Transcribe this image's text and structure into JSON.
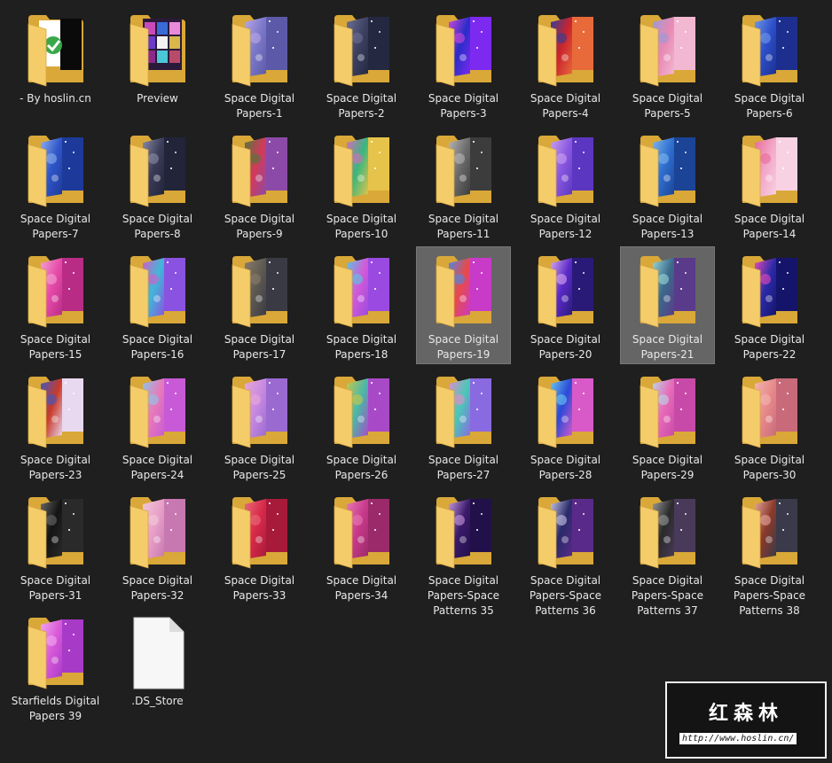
{
  "items": [
    {
      "label": "- By hoslin.cn",
      "kind": "folder",
      "thumb": "hoslin"
    },
    {
      "label": "Preview",
      "kind": "folder",
      "thumb": "preview"
    },
    {
      "label": "Space Digital Papers-1",
      "kind": "folder",
      "colors": [
        "#7b78c9",
        "#b9a8e6",
        "#5c5aa8"
      ]
    },
    {
      "label": "Space Digital Papers-2",
      "kind": "folder",
      "colors": [
        "#3d4263",
        "#6c7092",
        "#242841"
      ]
    },
    {
      "label": "Space Digital Papers-3",
      "kind": "folder",
      "colors": [
        "#2a2cc9",
        "#d04ad8",
        "#7d2af0"
      ]
    },
    {
      "label": "Space Digital Papers-4",
      "kind": "folder",
      "colors": [
        "#c9242d",
        "#2e3f9a",
        "#e86a3a"
      ]
    },
    {
      "label": "Space Digital Papers-5",
      "kind": "folder",
      "colors": [
        "#e889b4",
        "#9a9ad8",
        "#f2b8d2"
      ]
    },
    {
      "label": "Space Digital Papers-6",
      "kind": "folder",
      "colors": [
        "#2c4ec9",
        "#6f9ae8",
        "#1c2f8f"
      ]
    },
    {
      "label": "Space Digital Papers-7",
      "kind": "folder",
      "colors": [
        "#2f55c8",
        "#8fb0ee",
        "#1d3a9a"
      ]
    },
    {
      "label": "Space Digital Papers-8",
      "kind": "folder",
      "colors": [
        "#3a3c58",
        "#8b8da8",
        "#22243a"
      ]
    },
    {
      "label": "Space Digital Papers-9",
      "kind": "folder",
      "colors": [
        "#d33a5a",
        "#4f7a3a",
        "#8c4aa8"
      ]
    },
    {
      "label": "Space Digital Papers-10",
      "kind": "folder",
      "colors": [
        "#39b77e",
        "#d96ac0",
        "#e6c34a"
      ]
    },
    {
      "label": "Space Digital Papers-11",
      "kind": "folder",
      "colors": [
        "#6c6c6c",
        "#b8b8b8",
        "#3c3c3c"
      ]
    },
    {
      "label": "Space Digital Papers-12",
      "kind": "folder",
      "colors": [
        "#8a58e0",
        "#c9a2f2",
        "#5b36c0"
      ]
    },
    {
      "label": "Space Digital Papers-13",
      "kind": "folder",
      "colors": [
        "#2f6fd0",
        "#7fb6ec",
        "#1b4396"
      ]
    },
    {
      "label": "Space Digital Papers-14",
      "kind": "folder",
      "colors": [
        "#f2a8c8",
        "#e86a9a",
        "#f8d2e2"
      ]
    },
    {
      "label": "Space Digital Papers-15",
      "kind": "folder",
      "colors": [
        "#e64aa8",
        "#f2a2d2",
        "#b82c86"
      ]
    },
    {
      "label": "Space Digital Papers-16",
      "kind": "folder",
      "colors": [
        "#3fb8d8",
        "#d85ac8",
        "#8a52e0"
      ]
    },
    {
      "label": "Space Digital Papers-17",
      "kind": "folder",
      "colors": [
        "#5e5a52",
        "#8b7c6c",
        "#3a3a44"
      ]
    },
    {
      "label": "Space Digital Papers-18",
      "kind": "folder",
      "colors": [
        "#d25ad8",
        "#58c8e0",
        "#9a4ae0"
      ]
    },
    {
      "label": "Space Digital Papers-19",
      "kind": "folder",
      "selected": true,
      "colors": [
        "#e84a4a",
        "#4a8ae8",
        "#c83ac8"
      ]
    },
    {
      "label": "Space Digital Papers-20",
      "kind": "folder",
      "colors": [
        "#5a2ac8",
        "#d8a8f0",
        "#2a1a78"
      ]
    },
    {
      "label": "Space Digital Papers-21",
      "kind": "folder",
      "selected": true,
      "colors": [
        "#3a6a8a",
        "#9ad8d8",
        "#5a3a8a"
      ]
    },
    {
      "label": "Space Digital Papers-22",
      "kind": "folder",
      "colors": [
        "#2a2aa8",
        "#e84ab8",
        "#14146a"
      ]
    },
    {
      "label": "Space Digital Papers-23",
      "kind": "folder",
      "colors": [
        "#c83a2a",
        "#3a5ac8",
        "#e8d8f0"
      ]
    },
    {
      "label": "Space Digital Papers-24",
      "kind": "folder",
      "colors": [
        "#e87ab8",
        "#8ac8e8",
        "#c85ad8"
      ]
    },
    {
      "label": "Space Digital Papers-25",
      "kind": "folder",
      "colors": [
        "#c88ae0",
        "#e8a8d8",
        "#9a6ad0"
      ]
    },
    {
      "label": "Space Digital Papers-26",
      "kind": "folder",
      "colors": [
        "#4ab8a8",
        "#c8c84a",
        "#a84ac8"
      ]
    },
    {
      "label": "Space Digital Papers-27",
      "kind": "folder",
      "colors": [
        "#4ac8b8",
        "#e88ac8",
        "#8a6ae0"
      ]
    },
    {
      "label": "Space Digital Papers-28",
      "kind": "folder",
      "colors": [
        "#2a4ad8",
        "#6ac8f0",
        "#d85ac8"
      ]
    },
    {
      "label": "Space Digital Papers-29",
      "kind": "folder",
      "colors": [
        "#e86ab8",
        "#b8d8e8",
        "#c84aa8"
      ]
    },
    {
      "label": "Space Digital Papers-30",
      "kind": "folder",
      "colors": [
        "#e88a8a",
        "#f2b8b0",
        "#c86a7a"
      ]
    },
    {
      "label": "Space Digital Papers-31",
      "kind": "folder",
      "colors": [
        "#141414",
        "#6a6a6a",
        "#2a2a2a"
      ]
    },
    {
      "label": "Space Digital Papers-32",
      "kind": "folder",
      "colors": [
        "#e8a0c8",
        "#f2c8d8",
        "#c878b0"
      ]
    },
    {
      "label": "Space Digital Papers-33",
      "kind": "folder",
      "colors": [
        "#d82a4a",
        "#e86a7a",
        "#a81a3a"
      ]
    },
    {
      "label": "Space Digital Papers-34",
      "kind": "folder",
      "colors": [
        "#c83a8a",
        "#e87ab8",
        "#9a2a6a"
      ]
    },
    {
      "label": "Space Digital Papers-Space Patterns 35",
      "kind": "folder",
      "colors": [
        "#3a1a6a",
        "#c89ae0",
        "#22104a"
      ]
    },
    {
      "label": "Space Digital Papers-Space Patterns 36",
      "kind": "folder",
      "colors": [
        "#2a2a6a",
        "#c8c8e8",
        "#5a2a8a"
      ]
    },
    {
      "label": "Space Digital Papers-Space Patterns 37",
      "kind": "folder",
      "colors": [
        "#2a2a2a",
        "#9a9a9a",
        "#4a3a5a"
      ]
    },
    {
      "label": "Space Digital Papers-Space Patterns 38",
      "kind": "folder",
      "colors": [
        "#8a3a2a",
        "#e8a8a0",
        "#3a3a4a"
      ]
    },
    {
      "label": "Starfields Digital Papers 39",
      "kind": "folder",
      "colors": [
        "#d85ad8",
        "#f2a8f0",
        "#a83ac8"
      ]
    },
    {
      "label": ".DS_Store",
      "kind": "file"
    }
  ],
  "watermark": {
    "title": "红森林",
    "url": "http://www.hoslin.cn/"
  }
}
